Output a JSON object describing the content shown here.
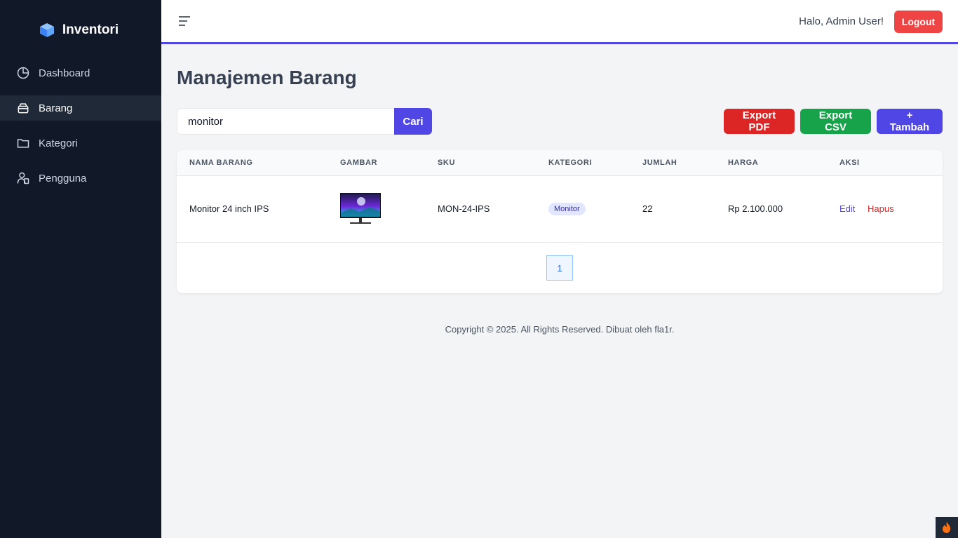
{
  "brand": {
    "name": "Inventori",
    "icon": "cube-icon"
  },
  "sidebar": {
    "items": [
      {
        "label": "Dashboard",
        "icon": "pie-chart-icon",
        "active": false
      },
      {
        "label": "Barang",
        "icon": "box-icon",
        "active": true
      },
      {
        "label": "Kategori",
        "icon": "folder-icon",
        "active": false
      },
      {
        "label": "Pengguna",
        "icon": "users-icon",
        "active": false
      }
    ]
  },
  "header": {
    "greeting": "Halo, Admin User!",
    "logout_label": "Logout"
  },
  "page": {
    "title": "Manajemen Barang"
  },
  "search": {
    "value": "monitor",
    "button_label": "Cari"
  },
  "actions": {
    "export_pdf": "Export PDF",
    "export_csv": "Export CSV",
    "add": "+ Tambah"
  },
  "table": {
    "headers": [
      "NAMA BARANG",
      "GAMBAR",
      "SKU",
      "KATEGORI",
      "JUMLAH",
      "HARGA",
      "AKSI"
    ],
    "rows": [
      {
        "name": "Monitor 24 inch IPS",
        "sku": "MON-24-IPS",
        "category": "Monitor",
        "quantity": "22",
        "price": "Rp 2.100.000",
        "edit": "Edit",
        "delete": "Hapus"
      }
    ]
  },
  "pagination": {
    "current": "1"
  },
  "footer": {
    "text": "Copyright © 2025. All Rights Reserved. Dibuat oleh fla1r."
  },
  "colors": {
    "sidebar_bg": "#111827",
    "accent": "#4f46e5",
    "danger": "#dc2626",
    "success": "#16a34a",
    "logout": "#ef4444"
  }
}
